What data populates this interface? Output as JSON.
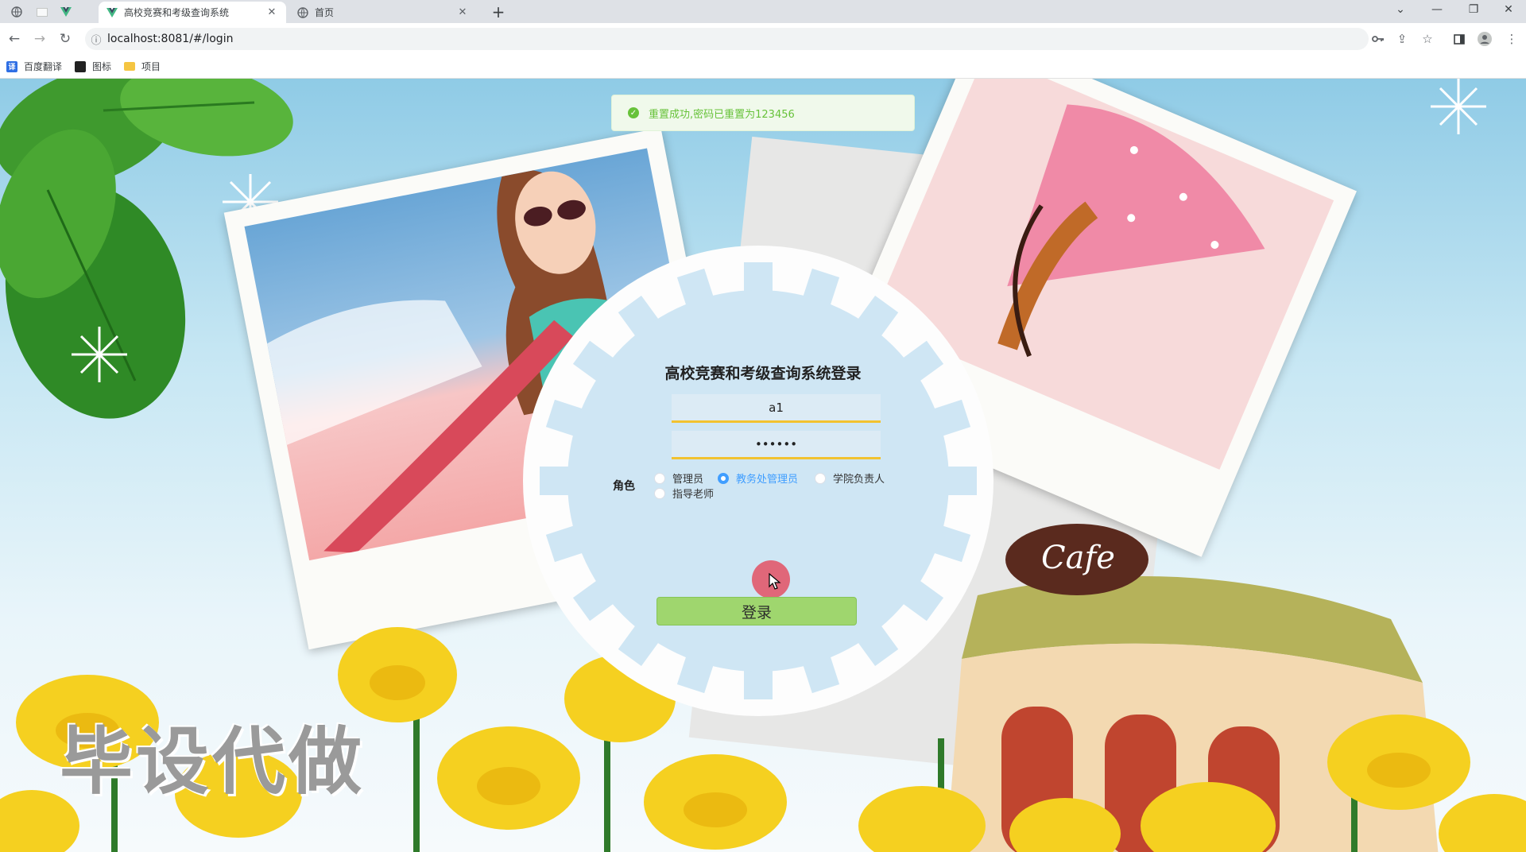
{
  "browser": {
    "tabs": [
      {
        "title": "高校竞赛和考级查询系统",
        "active": true,
        "icon": "vue-logo-icon"
      },
      {
        "title": "首页",
        "active": false,
        "icon": "globe-icon"
      }
    ],
    "new_tab": "+",
    "url": "localhost:8081/#/login",
    "bookmarks": [
      {
        "label": "百度翻译",
        "icon": "baidu-translate-icon",
        "color": "#2f6fe4"
      },
      {
        "label": "图标",
        "icon": "iconfont-icon",
        "color": "#222222"
      },
      {
        "label": "项目",
        "icon": "folder-icon",
        "color": "#f5c542"
      }
    ]
  },
  "toast": {
    "message": "重置成功,密码已重置为123456",
    "type": "success",
    "color": "#67c23a"
  },
  "login": {
    "title": "高校竞赛和考级查询系统登录",
    "username_value": "a1",
    "password_value": "123456",
    "role_label": "角色",
    "roles": [
      {
        "label": "管理员",
        "checked": false
      },
      {
        "label": "教务处管理员",
        "checked": true
      },
      {
        "label": "学院负责人",
        "checked": false
      },
      {
        "label": "指导老师",
        "checked": false
      }
    ],
    "submit_label": "登录",
    "button_color": "#9fd66e"
  },
  "background": {
    "sign_text": "Cafe"
  },
  "watermark": "毕设代做"
}
